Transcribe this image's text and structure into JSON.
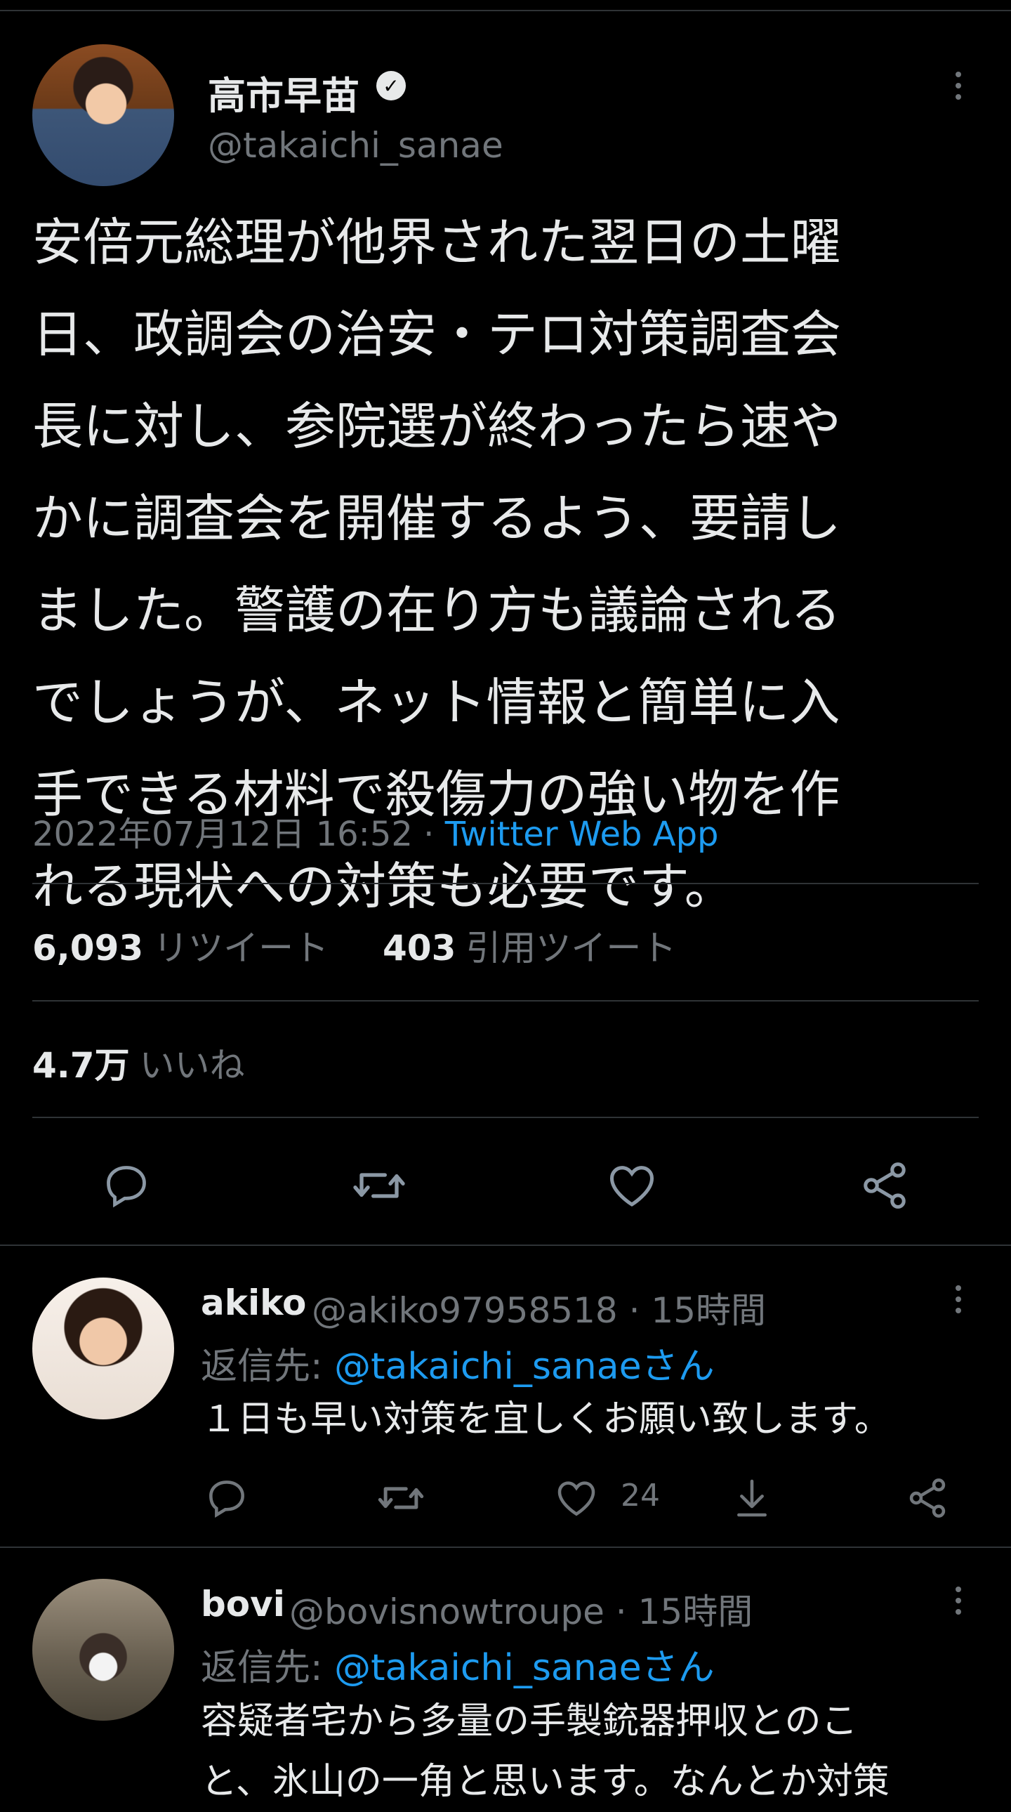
{
  "tweet": {
    "author_name": "高市早苗",
    "author_handle": "@takaichi_sanae",
    "text": "安倍元総理が他界された翌日の土曜\n日、政調会の治安・テロ対策調査会\n長に対し、参院選が終わったら速や\nかに調査会を開催するよう、要請し\nました。警護の在り方も議論される\nでしょうが、ネット情報と簡単に入\n手できる材料で殺傷力の強い物を作\nれる現状への対策も必要です。",
    "timestamp": "2022年07月12日 16:52",
    "separator": " · ",
    "source": "Twitter Web App",
    "retweets_count": "6,093",
    "retweets_label": "リツイート",
    "quotes_count": "403",
    "quotes_label": "引用ツイート",
    "likes_count": "4.7万",
    "likes_label": "いいね"
  },
  "replies": [
    {
      "name": "akiko",
      "handle": "@akiko97958518",
      "time": " · 15時間",
      "reply_to_prefix": "返信先: ",
      "reply_to_mention": "@takaichi_sanaeさん",
      "text": "１日も早い対策を宜しくお願い致します。",
      "like_count": "24"
    },
    {
      "name": "bovi",
      "handle": "@bovisnowtroupe",
      "time": " · 15時間",
      "reply_to_prefix": "返信先: ",
      "reply_to_mention": "@takaichi_sanaeさん",
      "text": "容疑者宅から多量の手製銃器押収とのこ\nと、氷山の一角と思います。なんとか対策"
    }
  ],
  "icons": [
    "verified-icon",
    "more-icon",
    "reply-icon",
    "retweet-icon",
    "like-icon",
    "share-icon",
    "download-icon"
  ],
  "colors": {
    "background": "#000000",
    "text": "#e7e9ea",
    "muted": "#71767b",
    "link": "#1d9bf0",
    "divider": "#2f3336"
  }
}
